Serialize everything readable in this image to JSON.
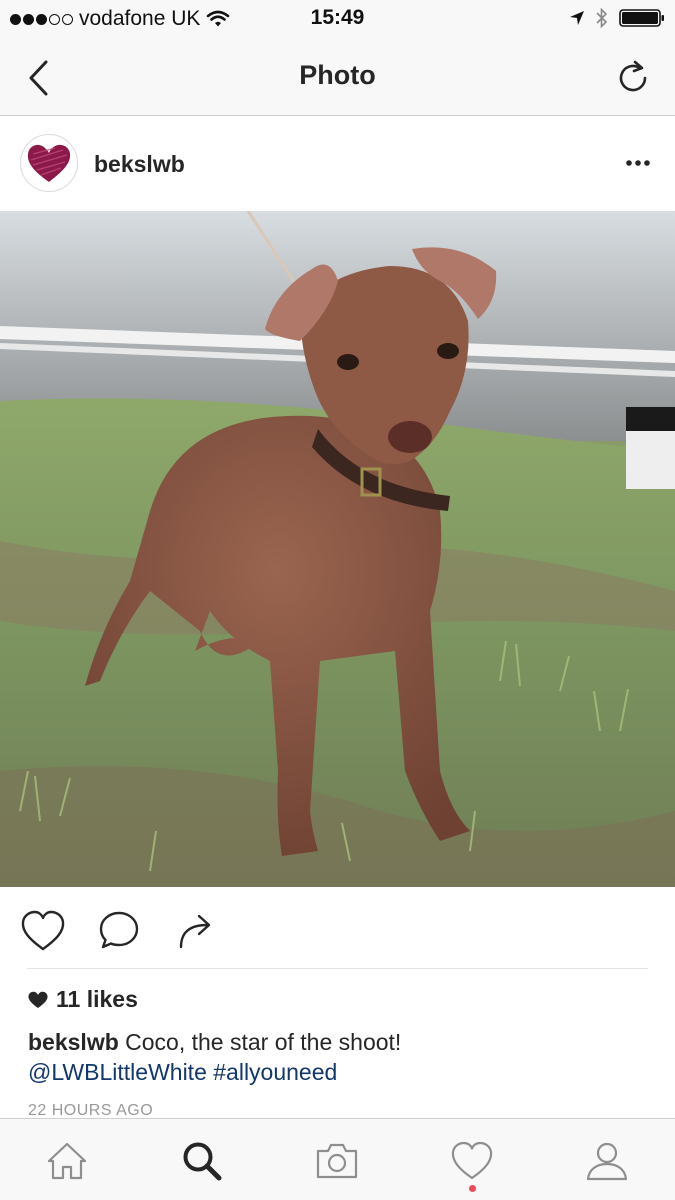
{
  "status_bar": {
    "carrier": "vodafone UK",
    "time": "15:49",
    "signal_bars_filled": 3,
    "signal_bars_total": 5,
    "battery_level": 1.0
  },
  "nav": {
    "title": "Photo",
    "back_icon": "chevron-left-icon",
    "refresh_icon": "refresh-icon"
  },
  "post": {
    "username": "bekslwb",
    "avatar_icon": "heart-scribble-icon",
    "more_icon": "more-dots-icon",
    "photo_subject": "brown dog with collar on grass",
    "likes_count": "11 likes",
    "caption_user": "bekslwb",
    "caption_text": " Coco, the star of the shoot!",
    "caption_mention": "@LWBLittleWhite",
    "caption_hashtag": "#allyouneed",
    "time_ago": "22 HOURS AGO"
  },
  "actions": {
    "like_icon": "heart-outline-icon",
    "comment_icon": "comment-bubble-icon",
    "share_icon": "share-arrow-icon"
  },
  "tab_bar": {
    "items": [
      "home-icon",
      "search-icon",
      "camera-icon",
      "activity-heart-icon",
      "profile-icon"
    ],
    "active": "search-icon",
    "colors": {
      "notification_dot": "#ed4956",
      "link": "#12386b",
      "avatar_heart": "#8b1a4a"
    }
  }
}
